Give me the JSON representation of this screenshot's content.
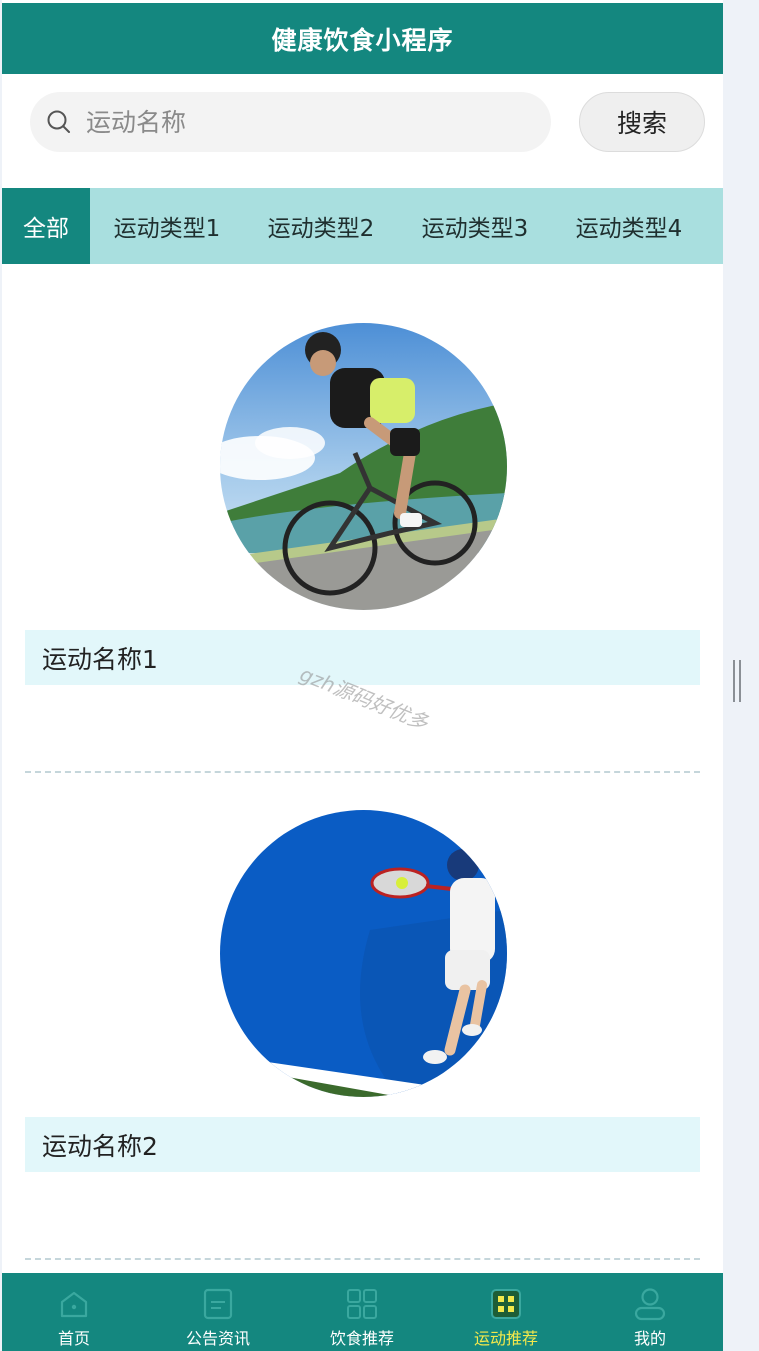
{
  "header": {
    "title": "健康饮食小程序"
  },
  "search": {
    "placeholder": "运动名称",
    "value": "",
    "button_label": "搜索"
  },
  "tabs": [
    {
      "label": "全部",
      "active": true
    },
    {
      "label": "运动类型1",
      "active": false
    },
    {
      "label": "运动类型2",
      "active": false
    },
    {
      "label": "运动类型3",
      "active": false
    },
    {
      "label": "运动类型4",
      "active": false
    }
  ],
  "items": [
    {
      "name": "运动名称1",
      "image": "cyclist-photo"
    },
    {
      "name": "运动名称2",
      "image": "tennis-player-photo"
    }
  ],
  "watermark": "gzh源码好优多",
  "nav": [
    {
      "label": "首页",
      "icon": "home-icon",
      "active": false
    },
    {
      "label": "公告资讯",
      "icon": "notice-icon",
      "active": false
    },
    {
      "label": "饮食推荐",
      "icon": "grid-icon",
      "active": false
    },
    {
      "label": "运动推荐",
      "icon": "sport-icon",
      "active": true
    },
    {
      "label": "我的",
      "icon": "user-icon",
      "active": false
    }
  ],
  "colors": {
    "primary": "#14877f",
    "tab_bg": "#a9dfdf",
    "name_bar_bg": "#e2f7fa",
    "nav_active": "#f3e84b"
  }
}
